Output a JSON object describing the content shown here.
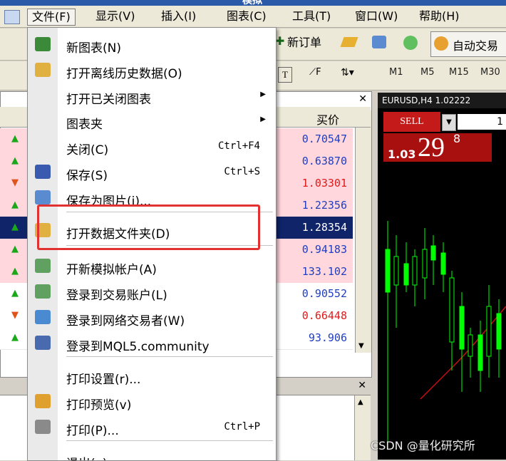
{
  "window": {
    "title": "模拟"
  },
  "menubar": {
    "items": [
      {
        "label": "文件(F)"
      },
      {
        "label": "显示(V)"
      },
      {
        "label": "插入(I)"
      },
      {
        "label": "图表(C)"
      },
      {
        "label": "工具(T)"
      },
      {
        "label": "窗口(W)"
      },
      {
        "label": "帮助(H)"
      }
    ]
  },
  "toolbar": {
    "new_order_label": "新订单",
    "auto_trade_label": "自动交易",
    "timeframes": [
      "M1",
      "M5",
      "M15",
      "M30"
    ]
  },
  "market_watch": {
    "header_price": "买价",
    "rows": [
      {
        "direction": "up",
        "price": "0.70547",
        "color": "#1f3ec0",
        "bg": "#ffd7dd"
      },
      {
        "direction": "up",
        "price": "0.63870",
        "color": "#1f3ec0",
        "bg": "#ffd7dd"
      },
      {
        "direction": "down",
        "price": "1.03301",
        "color": "#e01a1a",
        "bg": "#ffd7dd"
      },
      {
        "direction": "up",
        "price": "1.22356",
        "color": "#1f3ec0",
        "bg": "#ffd7dd"
      },
      {
        "direction": "up",
        "price": "1.28354",
        "color": "#ffffff",
        "bg": "#10246a"
      },
      {
        "direction": "up",
        "price": "0.94183",
        "color": "#1f3ec0",
        "bg": "#ffd7dd"
      },
      {
        "direction": "up",
        "price": "133.102",
        "color": "#1f3ec0",
        "bg": "#ffd7dd"
      },
      {
        "direction": "up",
        "price": "0.90552",
        "color": "#1f3ec0",
        "bg": "#ffffff"
      },
      {
        "direction": "down",
        "price": "0.66448",
        "color": "#e01a1a",
        "bg": "#ffffff"
      },
      {
        "direction": "up",
        "price": "93.906",
        "color": "#1f3ec0",
        "bg": "#ffffff"
      }
    ]
  },
  "chart": {
    "title": "EURUSD,H4  1.02222",
    "sell_label": "SELL",
    "lot_value": "1",
    "price_prefix": "1.03",
    "price_big": "29",
    "price_sup": "8"
  },
  "file_menu": {
    "items": [
      {
        "label": "新图表(N)",
        "icon": "new-chart-icon"
      },
      {
        "label": "打开离线历史数据(O)",
        "icon": "open-folder-icon"
      },
      {
        "label": "打开已关闭图表",
        "submenu": true
      },
      {
        "label": "图表夹",
        "submenu": true
      },
      {
        "label": "关闭(C)",
        "shortcut": "Ctrl+F4"
      },
      {
        "label": "保存(S)",
        "shortcut": "Ctrl+S",
        "icon": "save-icon"
      },
      {
        "label": "保存为图片(i)...",
        "icon": "save-picture-icon"
      },
      {
        "label": "打开数据文件夹(D)",
        "icon": "data-folder-icon"
      },
      {
        "label": "开新模拟帐户(A)",
        "icon": "new-account-icon"
      },
      {
        "label": "登录到交易账户(L)",
        "icon": "login-trade-icon"
      },
      {
        "label": "登录到网络交易者(W)",
        "icon": "login-web-icon"
      },
      {
        "label": "登录到MQL5.community",
        "icon": "mql5-icon"
      },
      {
        "label": "打印设置(r)..."
      },
      {
        "label": "打印预览(v)",
        "icon": "print-preview-icon"
      },
      {
        "label": "打印(P)...",
        "shortcut": "Ctrl+P",
        "icon": "print-icon"
      },
      {
        "label": "退出(x)"
      }
    ]
  },
  "watermark": "CSDN @量化研究所",
  "colors": {
    "highlight_border": "#e23131",
    "up_arrow": "#1aa81a",
    "down_arrow": "#e0531a"
  }
}
